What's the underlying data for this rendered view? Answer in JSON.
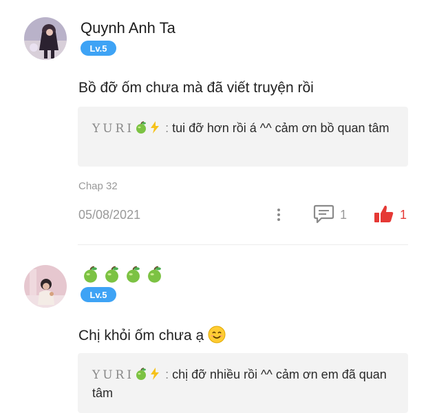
{
  "comments": [
    {
      "author": "Quynh Anh Ta",
      "level": "Lv.5",
      "text": "Bồ đỡ ốm chưa mà đã viết truyện rồi",
      "reply": {
        "author": "YURI",
        "author_icons": [
          "apple-icon",
          "lightning-icon"
        ],
        "text": "tui đỡ hơn rồi á ^^ cảm ơn bồ quan tâm"
      },
      "chapter": "Chap 32",
      "date": "05/08/2021",
      "comment_count": "1",
      "like_count": "1"
    },
    {
      "author_icons": [
        "apple-icon",
        "apple-icon",
        "apple-icon",
        "apple-icon"
      ],
      "level": "Lv.5",
      "text": "Chị khỏi ốm chưa ạ",
      "text_emoji": "smiling-face-icon",
      "reply": {
        "author": "YURI",
        "author_icons": [
          "apple-icon",
          "lightning-icon"
        ],
        "text": "chị đỡ nhiều rồi ^^ cảm ơn em đã quan tâm"
      }
    }
  ],
  "colors": {
    "badge": "#3ea3f5",
    "like": "#e53935",
    "muted": "#999999",
    "reply_bg": "#f3f3f3"
  }
}
